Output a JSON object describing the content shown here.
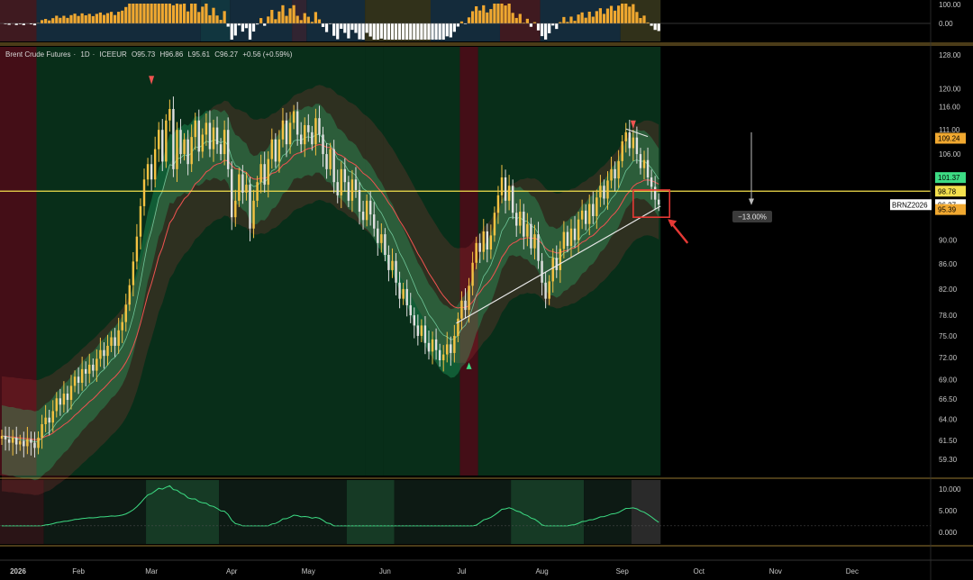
{
  "header": {
    "title": "Brent Crude Futures",
    "interval": "1D",
    "exchange": "ICEEUR",
    "open_label": "O",
    "open": "95.73",
    "high_label": "H",
    "high": "96.86",
    "low_label": "L",
    "low": "95.61",
    "close_label": "C",
    "close": "96.27",
    "change": "+0.56 (+0.59%)"
  },
  "colors": {
    "up_candle": "#f5c242",
    "down_candle": "#e0e0e0",
    "band_green": "#1f8c5c",
    "band_red": "#8c3a3a",
    "ema_red": "#ef5350",
    "trendline": "#e6e6e6",
    "horizontal_level": "#f4e04d",
    "callout": "#e53935",
    "histogram_up": "#f0a830",
    "histogram_down": "#ffffff",
    "osc_green": "#3ddc84"
  },
  "price_scale": {
    "ticks": [
      "128.00",
      "120.00",
      "116.00",
      "111.00",
      "106.00",
      "101.37",
      "98.78",
      "96.27",
      "95.39",
      "90.00",
      "86.00",
      "82.00",
      "78.00",
      "75.00",
      "72.00",
      "69.00",
      "66.50",
      "64.00",
      "61.50",
      "59.30"
    ],
    "tags": [
      {
        "label": "109.24",
        "value": 109.24,
        "bg": "#f0a830",
        "fg": "#000000"
      },
      {
        "label": "101.37",
        "value": 101.37,
        "bg": "#3ddc84",
        "fg": "#000000"
      },
      {
        "label": "98.78",
        "value": 98.78,
        "bg": "#f4e04d",
        "fg": "#000000"
      },
      {
        "label": "96.27",
        "value": 96.27,
        "bg": "#ffffff",
        "fg": "#000000"
      },
      {
        "label": "95.39",
        "value": 95.39,
        "bg": "#f0a830",
        "fg": "#000000"
      }
    ],
    "symbol_tag": "BRNZ2026"
  },
  "top_panel": {
    "ticks": [
      "100.00",
      "0.00"
    ]
  },
  "bottom_panel": {
    "ticks": [
      "10.000",
      "5.000",
      "0.000"
    ]
  },
  "annotations": {
    "pct_label": "−13.00%"
  },
  "chart_data": {
    "type": "candlestick",
    "x_labels": [
      "2026",
      "Feb",
      "Mar",
      "Apr",
      "May",
      "Jun",
      "Jul",
      "Aug",
      "Sep",
      "Oct",
      "Nov",
      "Dec"
    ],
    "ylim": [
      57.5,
      130
    ],
    "y_scale": "log",
    "horizontal_level": 98.78,
    "last_close": 96.27,
    "month_starts": [
      0,
      21,
      41,
      63,
      84,
      105,
      126,
      148,
      170,
      191
    ],
    "close_series": [
      62.0,
      61.6,
      61.2,
      61.8,
      61.0,
      61.4,
      60.8,
      61.6,
      61.2,
      60.6,
      61.8,
      63.4,
      64.2,
      63.6,
      65.0,
      66.6,
      65.8,
      67.2,
      66.4,
      68.2,
      69.4,
      68.6,
      70.4,
      69.8,
      71.0,
      70.2,
      71.8,
      73.0,
      72.2,
      73.6,
      74.8,
      73.6,
      75.8,
      77.0,
      79.6,
      82.6,
      86.4,
      90.6,
      96.0,
      101.0,
      104.0,
      101.0,
      107.0,
      111.0,
      104.5,
      113.0,
      115.5,
      103.0,
      111.0,
      106.0,
      109.0,
      104.0,
      109.5,
      113.0,
      106.5,
      110.0,
      112.5,
      107.0,
      111.5,
      108.0,
      106.0,
      111.0,
      103.0,
      94.0,
      97.0,
      102.0,
      98.5,
      100.0,
      92.0,
      97.0,
      100.5,
      104.0,
      100.0,
      105.0,
      109.0,
      104.5,
      109.0,
      113.0,
      108.0,
      112.5,
      115.0,
      110.0,
      108.0,
      112.0,
      110.5,
      108.0,
      113.5,
      110.0,
      106.0,
      103.0,
      107.0,
      100.5,
      98.0,
      103.0,
      100.5,
      97.0,
      101.0,
      99.0,
      95.0,
      93.5,
      97.0,
      94.5,
      92.0,
      89.5,
      91.0,
      87.5,
      85.0,
      86.5,
      83.0,
      80.5,
      82.0,
      79.5,
      78.0,
      76.5,
      75.0,
      76.5,
      74.0,
      72.8,
      74.5,
      73.0,
      71.6,
      72.4,
      73.8,
      72.6,
      75.0,
      77.5,
      80.2,
      78.8,
      82.5,
      86.2,
      89.5,
      88.0,
      91.5,
      88.4,
      90.8,
      94.8,
      98.0,
      101.4,
      97.0,
      99.8,
      94.8,
      92.5,
      95.0,
      90.6,
      92.8,
      88.6,
      91.0,
      86.5,
      83.0,
      80.5,
      83.2,
      87.0,
      85.0,
      88.5,
      91.4,
      89.0,
      92.0,
      90.0,
      93.6,
      95.2,
      92.8,
      96.4,
      94.2,
      97.6,
      99.8,
      97.4,
      100.8,
      103.0,
      101.2,
      104.6,
      108.6,
      110.5,
      107.2,
      109.4,
      106.0,
      103.2,
      104.8,
      101.4,
      99.6,
      97.2,
      96.27
    ]
  }
}
